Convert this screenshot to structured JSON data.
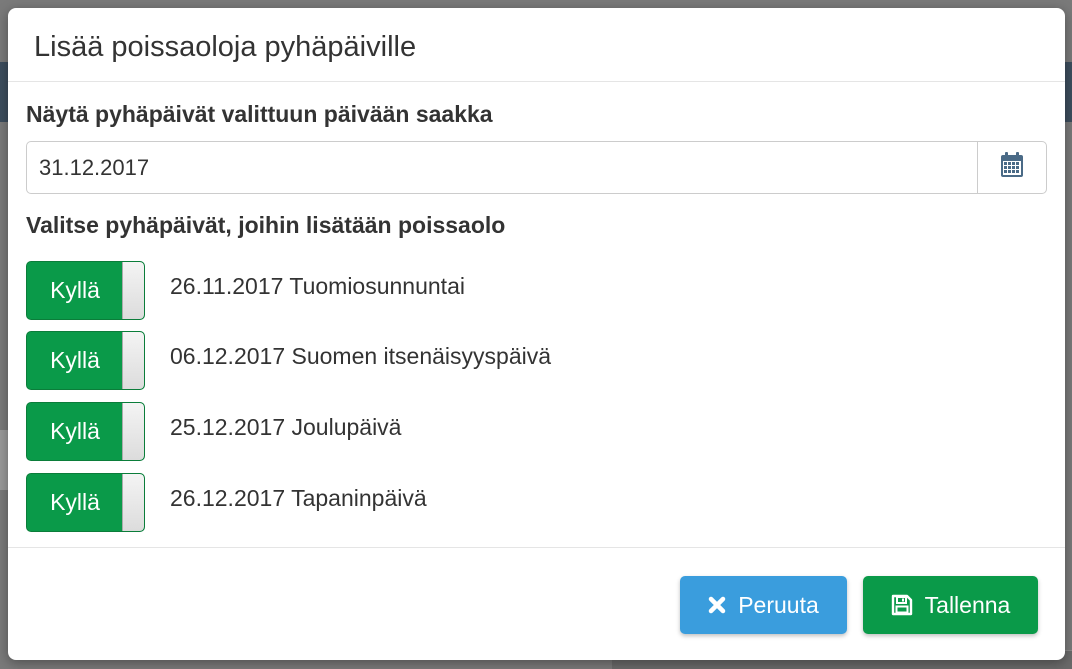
{
  "dialog": {
    "title": "Lisää poissaoloja pyhäpäiville",
    "date_label": "Näytä pyhäpäivät valittuun päivään saakka",
    "date_value": "31.12.2017",
    "calendar_icon": "calendar-icon",
    "select_label": "Valitse pyhäpäivät, joihin lisätään poissaolo",
    "holidays": [
      {
        "toggle_label": "Kyllä",
        "text": "26.11.2017 Tuomiosunnuntai"
      },
      {
        "toggle_label": "Kyllä",
        "text": "06.12.2017 Suomen itsenäisyyspäivä"
      },
      {
        "toggle_label": "Kyllä",
        "text": "25.12.2017 Joulupäivä"
      },
      {
        "toggle_label": "Kyllä",
        "text": "26.12.2017 Tapaninpäivä"
      }
    ],
    "cancel_label": "Peruuta",
    "cancel_icon": "close-icon",
    "save_label": "Tallenna",
    "save_icon": "floppy-disk-icon"
  },
  "colors": {
    "toggle_on": "#0a9a49",
    "cancel_button": "#3a9ddd",
    "save_button": "#0a9a49"
  }
}
